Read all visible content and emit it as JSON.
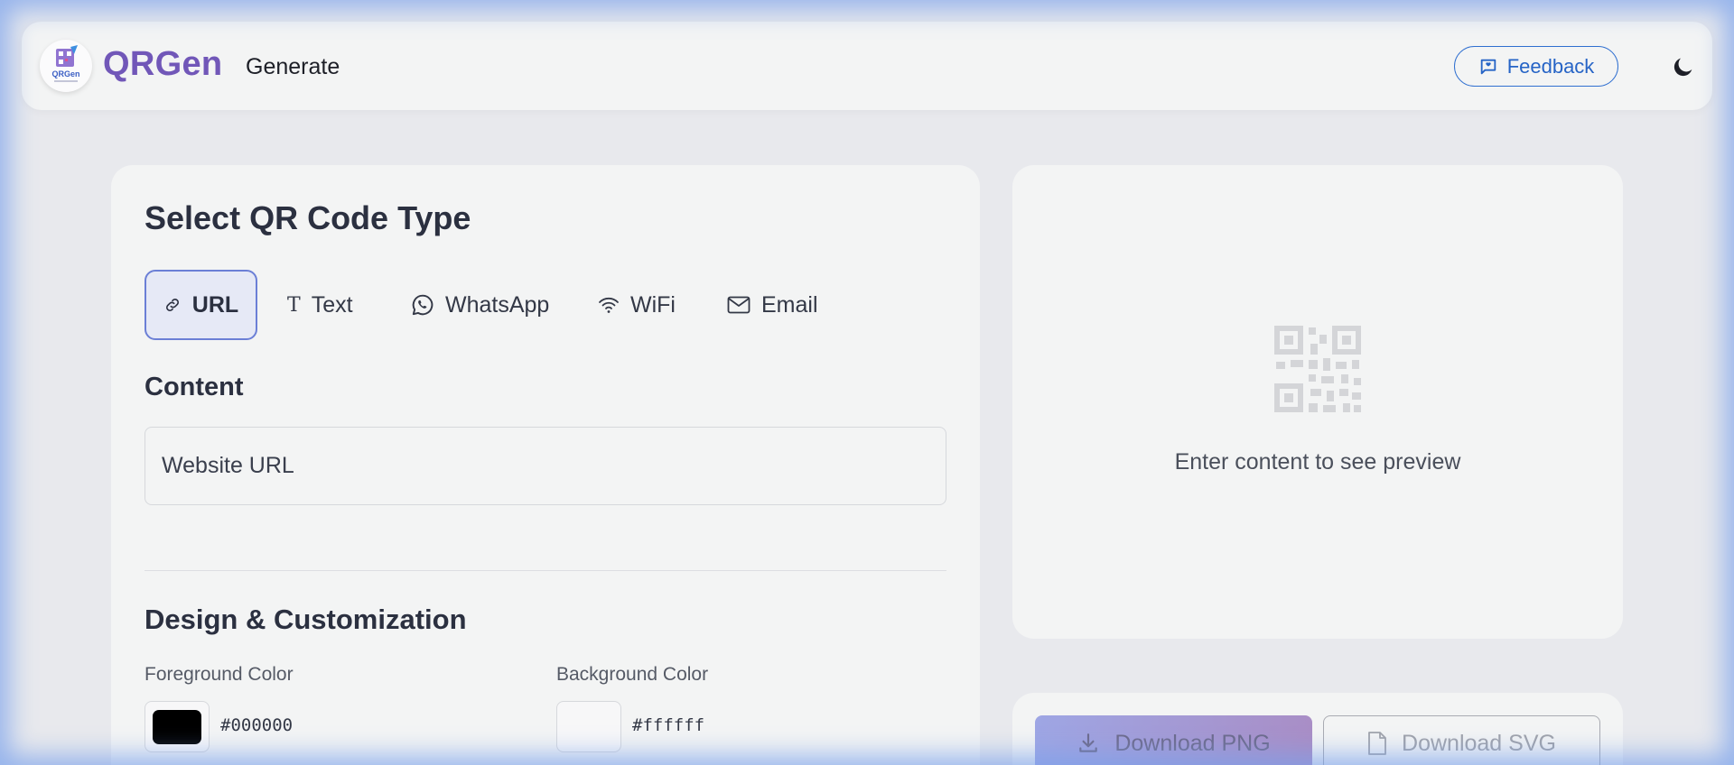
{
  "header": {
    "brand": "QRGen",
    "logo_text": "QRGen",
    "nav_generate": "Generate",
    "feedback_label": "Feedback"
  },
  "type_selector": {
    "title": "Select QR Code Type",
    "tabs": [
      {
        "label": "URL",
        "icon": "link-icon",
        "active": true
      },
      {
        "label": "Text",
        "icon": "text-icon",
        "active": false
      },
      {
        "label": "WhatsApp",
        "icon": "whatsapp-icon",
        "active": false
      },
      {
        "label": "WiFi",
        "icon": "wifi-icon",
        "active": false
      },
      {
        "label": "Email",
        "icon": "mail-icon",
        "active": false
      }
    ]
  },
  "content": {
    "title": "Content",
    "url_placeholder": "Website URL",
    "url_value": ""
  },
  "design": {
    "title": "Design & Customization",
    "foreground_label": "Foreground Color",
    "foreground_value": "#000000",
    "background_label": "Background Color",
    "background_value": "#ffffff"
  },
  "preview": {
    "empty_text": "Enter content to see preview"
  },
  "downloads": {
    "png_label": "Download PNG",
    "svg_label": "Download SVG"
  },
  "colors": {
    "brand": "#7157b8",
    "accent": "#6b7fd6",
    "feedback": "#2664c6"
  }
}
